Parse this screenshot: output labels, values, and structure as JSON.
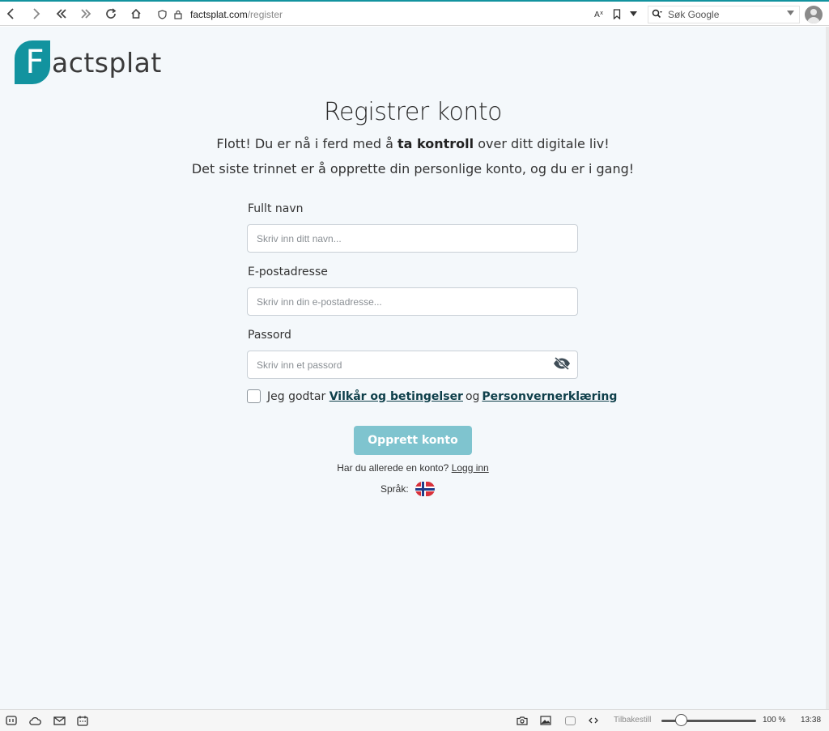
{
  "browser": {
    "url_domain": "factsplat.com",
    "url_path": "/register",
    "search_placeholder": "Søk Google",
    "reset_label": "Tilbakestill",
    "zoom": "100 %",
    "clock": "13:38"
  },
  "brand": {
    "logo_letter": "F",
    "logo_text": "actsplat",
    "color": "#12939f"
  },
  "page": {
    "title": "Registrer konto",
    "subtitle_pre": "Flott! Du er nå i ferd med å ",
    "subtitle_bold": "ta kontroll",
    "subtitle_post": " over ditt digitale liv!",
    "subtitle2": "Det siste trinnet er å opprette din personlige konto, og du er i gang!"
  },
  "form": {
    "name_label": "Fullt navn",
    "name_placeholder": "Skriv inn ditt navn...",
    "email_label": "E-postadresse",
    "email_placeholder": "Skriv inn din e-postadresse...",
    "password_label": "Passord",
    "password_placeholder": "Skriv inn et passord",
    "terms_prefix": "Jeg godtar",
    "terms_link": "Vilkår og betingelser",
    "terms_and": "og",
    "privacy_link": "Personvernerklæring",
    "submit_label": "Opprett konto",
    "have_account": "Har du allerede en konto?",
    "login_link": "Logg inn",
    "language_label": "Språk:"
  },
  "colors": {
    "accent_line": "#12939f",
    "button": "#7fc4cf",
    "link": "#0e3f4a",
    "page_bg": "#f4f8fb"
  }
}
